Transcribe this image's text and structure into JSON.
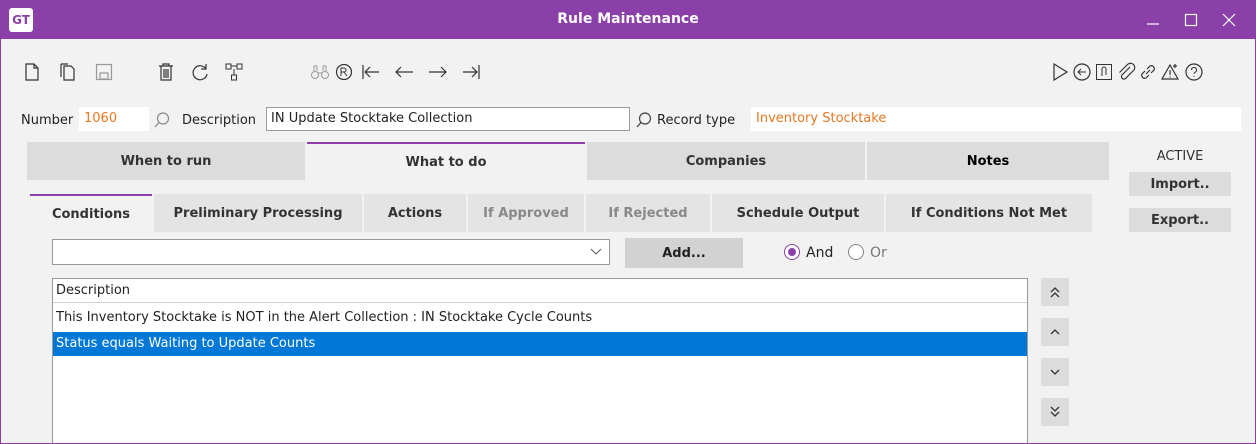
{
  "window": {
    "title": "Rule Maintenance",
    "logo_text": "GT"
  },
  "fields": {
    "number_label": "Number",
    "number_value": "1060",
    "description_label": "Description",
    "description_value": "IN Update Stocktake Collection",
    "record_type_label": "Record type",
    "record_type_value": "Inventory Stocktake"
  },
  "main_tabs": [
    {
      "label": "When to run"
    },
    {
      "label": "What to do"
    },
    {
      "label": "Companies"
    },
    {
      "label": "Notes"
    }
  ],
  "side_panel": {
    "status": "ACTIVE",
    "import_label": "Import..",
    "export_label": "Export.."
  },
  "sub_tabs": [
    {
      "label": "Conditions"
    },
    {
      "label": "Preliminary Processing"
    },
    {
      "label": "Actions"
    },
    {
      "label": "If Approved"
    },
    {
      "label": "If Rejected"
    },
    {
      "label": "Schedule Output"
    },
    {
      "label": "If Conditions Not Met"
    }
  ],
  "conditions": {
    "combo_value": "",
    "add_label": "Add...",
    "and_label": "And",
    "or_label": "Or",
    "selected_logic": "And",
    "list_header": "Description",
    "rows": [
      {
        "text": "This Inventory Stocktake is NOT in the Alert Collection : IN Stocktake Cycle Counts",
        "selected": false
      },
      {
        "text": "Status equals Waiting to Update Counts",
        "selected": true
      }
    ]
  },
  "colors": {
    "accent": "#8b3fa8",
    "selection": "#0078d7",
    "highlight_text": "#e87722"
  }
}
